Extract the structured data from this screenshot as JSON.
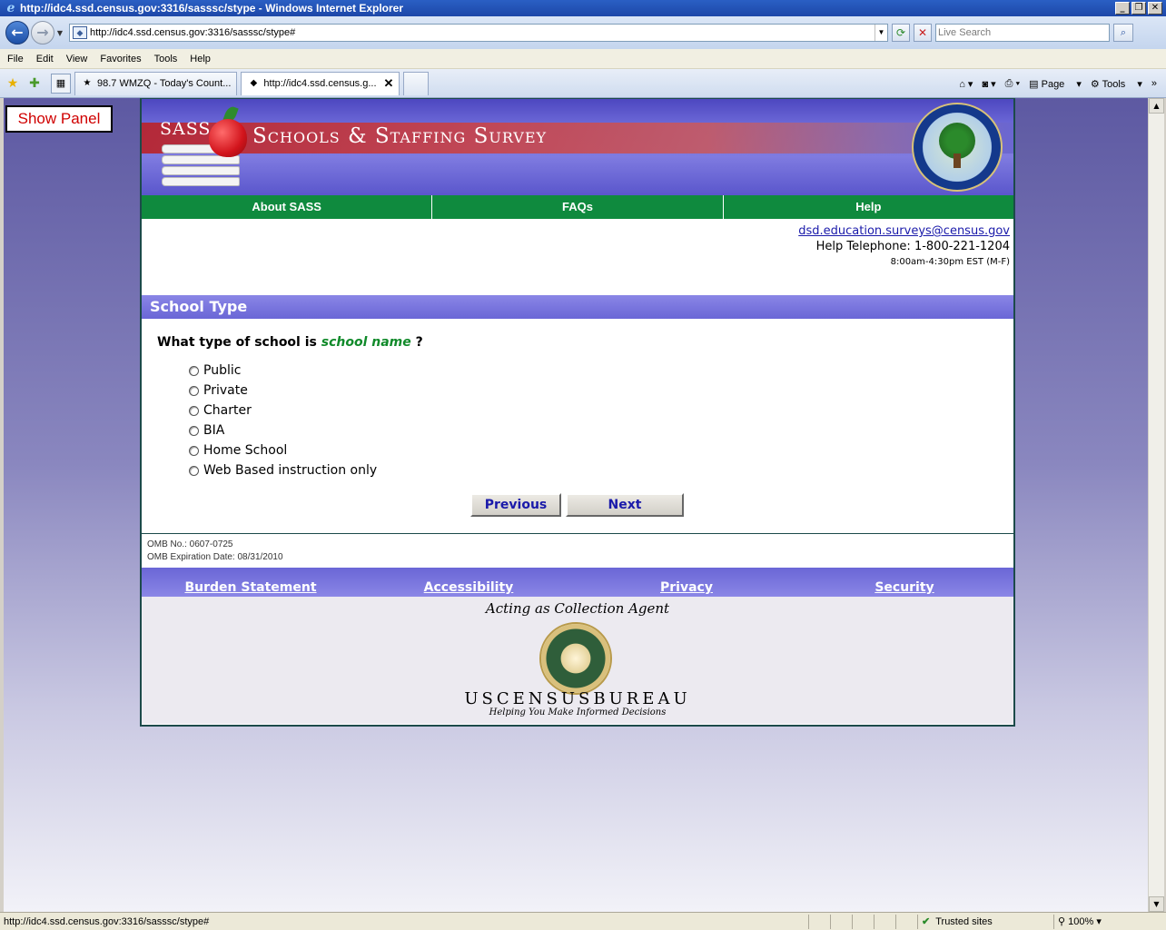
{
  "window": {
    "title": "http://idc4.ssd.census.gov:3316/sasssc/stype - Windows Internet Explorer"
  },
  "addressbar": {
    "url": "http://idc4.ssd.census.gov:3316/sasssc/stype#",
    "search_placeholder": "Live Search"
  },
  "menu": [
    "File",
    "Edit",
    "View",
    "Favorites",
    "Tools",
    "Help"
  ],
  "tabs": [
    {
      "label": "98.7 WMZQ - Today's Count..."
    },
    {
      "label": "http://idc4.ssd.census.g..."
    }
  ],
  "toolbar_right": {
    "page_label": "Page",
    "tools_label": "Tools"
  },
  "show_panel": "Show Panel",
  "banner": {
    "sass": "SASS",
    "title": "Schools & Staffing Survey"
  },
  "nav": [
    "About SASS",
    "FAQs",
    "Help"
  ],
  "contact": {
    "email": "dsd.education.surveys@census.gov",
    "phone": "Help Telephone: 1-800-221-1204",
    "hours": "8:00am-4:30pm EST (M-F)"
  },
  "section_title": "School Type",
  "question": {
    "prefix": "What type of school is",
    "school_name": "school name",
    "suffix": "?"
  },
  "options": [
    "Public",
    "Private",
    "Charter",
    "BIA",
    "Home School",
    "Web Based instruction only"
  ],
  "buttons": {
    "previous": "Previous",
    "next": "Next"
  },
  "omb": {
    "number": "OMB No.: 0607-0725",
    "expiration": "OMB Expiration Date: 08/31/2010"
  },
  "footer_links": [
    "Burden Statement",
    "Accessibility",
    "Privacy",
    "Security"
  ],
  "collection": {
    "agent": "Acting as Collection Agent",
    "bureau": "USCENSUSBUREAU",
    "tagline": "Helping You Make Informed Decisions"
  },
  "status": {
    "url": "http://idc4.ssd.census.gov:3316/sasssc/stype#",
    "zone": "Trusted sites",
    "zoom": "100%"
  }
}
